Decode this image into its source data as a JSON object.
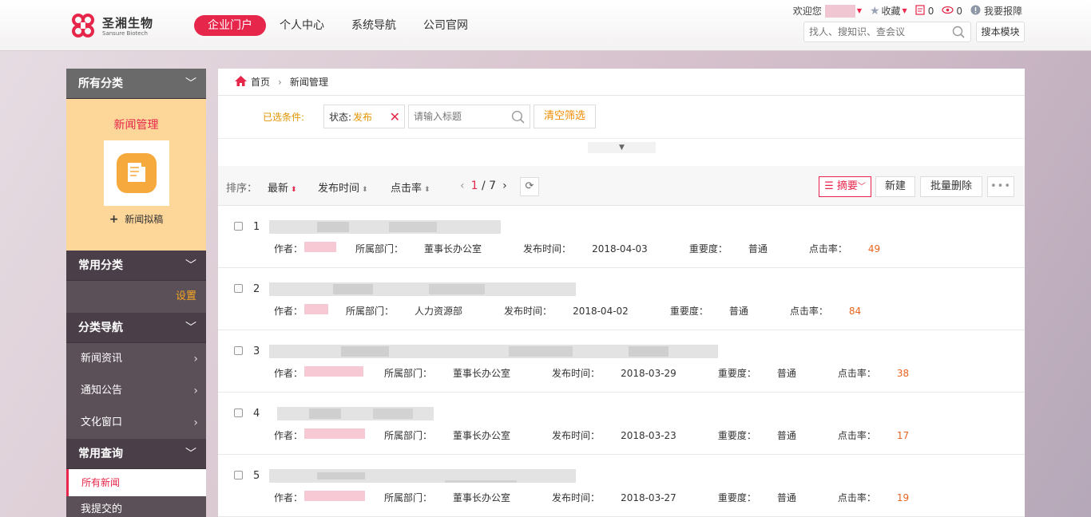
{
  "header": {
    "logo_cn": "圣湘生物",
    "logo_en": "Sansure Biotech",
    "nav": [
      {
        "label": "企业门户",
        "active": true
      },
      {
        "label": "个人中心",
        "active": false
      },
      {
        "label": "系统导航",
        "active": false
      },
      {
        "label": "公司官网",
        "active": false
      }
    ],
    "welcome": "欢迎您",
    "favorites": "收藏",
    "task_count": "0",
    "view_count": "0",
    "report": "我要报障",
    "search_placeholder": "找人、搜知识、查会议",
    "search_module": "搜本模块"
  },
  "sidebar": {
    "all_categories": "所有分类",
    "news_admin": "新闻管理",
    "news_draft": "新闻拟稿",
    "common_categories": "常用分类",
    "settings": "设置",
    "category_nav": "分类导航",
    "nav_items": [
      "新闻资讯",
      "通知公告",
      "文化窗口"
    ],
    "common_query": "常用查询",
    "query_items": [
      "所有新闻",
      "我提交的"
    ]
  },
  "breadcrumb": {
    "home": "首页",
    "current": "新闻管理"
  },
  "filter": {
    "selected_label": "已选条件:",
    "status_key": "状态:",
    "status_value": "发布",
    "title_placeholder": "请输入标题",
    "clear": "清空筛选"
  },
  "toolbar": {
    "sort_label": "排序：",
    "sort_options": [
      "最新",
      "发布时间",
      "点击率"
    ],
    "page_current": "1",
    "page_total": "7",
    "summary": "摘要",
    "new": "新建",
    "bulk_delete": "批量删除",
    "more": "•••"
  },
  "labels": {
    "author": "作者：",
    "dept": "所属部门：",
    "publish_time": "发布时间：",
    "importance": "重要度：",
    "clicks": "点击率："
  },
  "rows": [
    {
      "num": "1",
      "dept": "董事长办公室",
      "date": "2018-04-03",
      "importance": "普通",
      "clicks": "49"
    },
    {
      "num": "2",
      "dept": "人力资源部",
      "date": "2018-04-02",
      "importance": "普通",
      "clicks": "84"
    },
    {
      "num": "3",
      "dept": "董事长办公室",
      "date": "2018-03-29",
      "importance": "普通",
      "clicks": "38"
    },
    {
      "num": "4",
      "dept": "董事长办公室",
      "date": "2018-03-23",
      "importance": "普通",
      "clicks": "17"
    },
    {
      "num": "5",
      "dept": "董事长办公室",
      "date": "2018-03-27",
      "importance": "普通",
      "clicks": "19"
    }
  ],
  "colors": {
    "brand": "#e6264a",
    "accent": "#f5a623",
    "sidebar": "#5b4f58"
  }
}
